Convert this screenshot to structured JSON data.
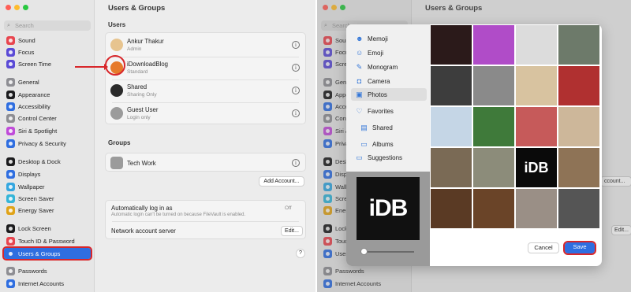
{
  "colors": {
    "accent": "#2f6ee0",
    "highlight_red": "#d8262a"
  },
  "left_window": {
    "search_placeholder": "Search",
    "sidebar": [
      {
        "label": "Sound",
        "icon": "speaker-icon",
        "color": "#e8464f"
      },
      {
        "label": "Focus",
        "icon": "moon-icon",
        "color": "#5b4bd6"
      },
      {
        "label": "Screen Time",
        "icon": "hourglass-icon",
        "color": "#5b4bd6"
      },
      {
        "label": "General",
        "icon": "gear-icon",
        "color": "#8e8e93"
      },
      {
        "label": "Appearance",
        "icon": "appearance-icon",
        "color": "#1c1c1e"
      },
      {
        "label": "Accessibility",
        "icon": "accessibility-icon",
        "color": "#2f6ee0"
      },
      {
        "label": "Control Center",
        "icon": "control-center-icon",
        "color": "#8e8e93"
      },
      {
        "label": "Siri & Spotlight",
        "icon": "siri-icon",
        "color": "#c04cd9"
      },
      {
        "label": "Privacy & Security",
        "icon": "hand-icon",
        "color": "#2f6ee0"
      },
      {
        "label": "Desktop & Dock",
        "icon": "dock-icon",
        "color": "#1c1c1e"
      },
      {
        "label": "Displays",
        "icon": "display-icon",
        "color": "#2f6ee0"
      },
      {
        "label": "Wallpaper",
        "icon": "wallpaper-icon",
        "color": "#35a7e0"
      },
      {
        "label": "Screen Saver",
        "icon": "screensaver-icon",
        "color": "#35b5d8"
      },
      {
        "label": "Energy Saver",
        "icon": "battery-icon",
        "color": "#e0a318"
      },
      {
        "label": "Lock Screen",
        "icon": "lock-icon",
        "color": "#1c1c1e"
      },
      {
        "label": "Touch ID & Password",
        "icon": "fingerprint-icon",
        "color": "#e8464f"
      },
      {
        "label": "Users & Groups",
        "icon": "users-icon",
        "color": "#2f6ee0"
      },
      {
        "label": "Passwords",
        "icon": "key-icon",
        "color": "#8e8e93"
      },
      {
        "label": "Internet Accounts",
        "icon": "at-icon",
        "color": "#2f6ee0"
      }
    ],
    "title": "Users & Groups",
    "users_heading": "Users",
    "users": [
      {
        "name": "Ankur Thakur",
        "role": "Admin",
        "avatar_color": "#e7c48f"
      },
      {
        "name": "iDownloadBlog",
        "role": "Standard",
        "avatar_color": "#e67a2b"
      },
      {
        "name": "Shared",
        "role": "Sharing Only",
        "avatar_color": "#2b2b2b"
      },
      {
        "name": "Guest User",
        "role": "Login only",
        "avatar_color": "#9b9b9b"
      }
    ],
    "groups_heading": "Groups",
    "groups": [
      {
        "name": "Tech Work"
      }
    ],
    "add_account_label": "Add Account...",
    "auto_login_label": "Automatically log in as",
    "auto_login_note": "Automatic login can't be turned on because FileVault is enabled.",
    "auto_login_value": "Off",
    "network_label": "Network account server",
    "edit_label": "Edit...",
    "help_label": "?"
  },
  "right_window": {
    "bg_title": "Users & Groups",
    "bg_sidebar": [
      "Sound",
      "Focus",
      "Screen Time",
      "General",
      "Appearance",
      "Accessibility",
      "Control Center",
      "Siri & Spotlight",
      "Privacy & Security",
      "Desktop & Dock",
      "Displays",
      "Wallpaper",
      "Screen Saver",
      "Energy Saver",
      "Lock Screen",
      "Touch ID & Password",
      "Users & Groups",
      "Passwords",
      "Internet Accounts"
    ],
    "bg_add_account": "ccount...",
    "bg_edit": "Edit...",
    "picker_items": [
      {
        "label": "Memoji",
        "icon": "memoji-icon",
        "glyph": "☻"
      },
      {
        "label": "Emoji",
        "icon": "emoji-icon",
        "glyph": "☺"
      },
      {
        "label": "Monogram",
        "icon": "pencil-icon",
        "glyph": "✎"
      },
      {
        "label": "Camera",
        "icon": "camera-icon",
        "glyph": "◘"
      },
      {
        "label": "Photos",
        "icon": "photos-icon",
        "glyph": "▣"
      },
      {
        "label": "Favorites",
        "icon": "heart-icon",
        "glyph": "♡"
      },
      {
        "label": "Shared",
        "icon": "shared-album-icon",
        "glyph": "▤"
      },
      {
        "label": "Albums",
        "icon": "albums-icon",
        "glyph": "▭"
      },
      {
        "label": "Suggestions",
        "icon": "folder-icon",
        "glyph": "▭"
      }
    ],
    "preview_text": "iDB",
    "photo_tiles": [
      {
        "color": "#2b1a1a"
      },
      {
        "color": "#b04cc8"
      },
      {
        "color": "#dcdcdc"
      },
      {
        "color": "#6d7a6a"
      },
      {
        "color": "#3d3d3d"
      },
      {
        "color": "#8a8a8a"
      },
      {
        "color": "#d8c3a0"
      },
      {
        "color": "#b03030"
      },
      {
        "color": "#c5d6e6"
      },
      {
        "color": "#3f7a3a"
      },
      {
        "color": "#c65a5a"
      },
      {
        "color": "#cdb79a"
      },
      {
        "color": "#7a6a55"
      },
      {
        "color": "#8c8c7a"
      },
      {
        "color": "#0a0a0a",
        "label": "iDB"
      },
      {
        "color": "#8e7356"
      },
      {
        "color": "#5a3a24"
      },
      {
        "color": "#6a4428"
      },
      {
        "color": "#9a8f86"
      },
      {
        "color": "#555555"
      }
    ],
    "cancel_label": "Cancel",
    "save_label": "Save"
  }
}
